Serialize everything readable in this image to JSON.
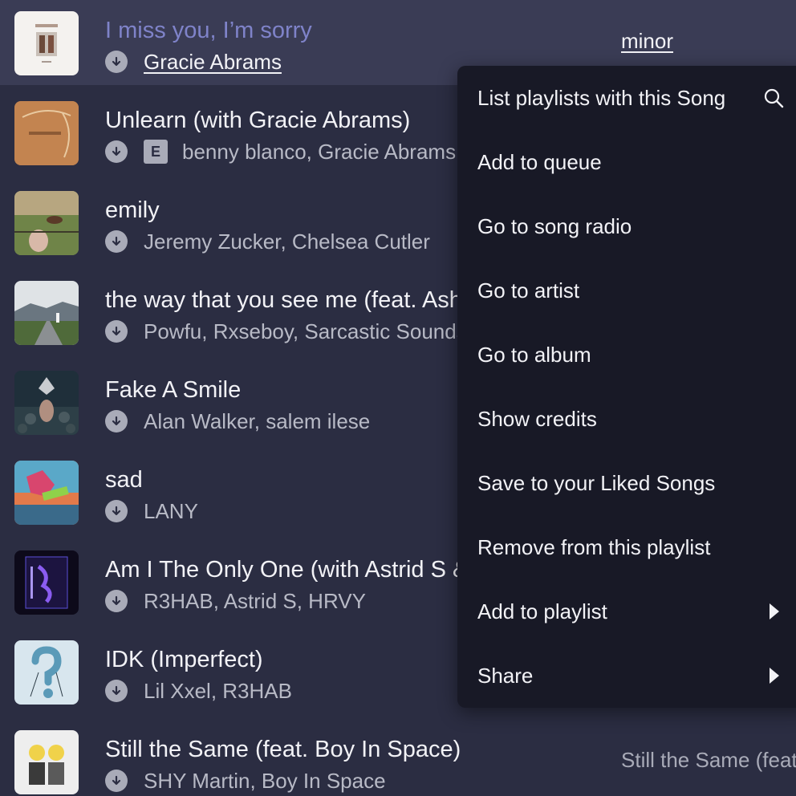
{
  "tracks": [
    {
      "title": "I miss you, I’m sorry",
      "artists": "Gracie Abrams",
      "explicit": false,
      "album": "minor",
      "selected": true
    },
    {
      "title": "Unlearn (with Gracie Abrams)",
      "artists": "benny blanco, Gracie Abrams",
      "explicit": true,
      "explicit_label": "E"
    },
    {
      "title": "emily",
      "artists": "Jeremy Zucker, Chelsea Cutler",
      "explicit": false
    },
    {
      "title": "the way that you see me (feat. Ashnikko)",
      "artists": "Powfu, Rxseboy, Sarcastic Sounds",
      "explicit": false
    },
    {
      "title": "Fake A Smile",
      "artists": "Alan Walker, salem ilese",
      "explicit": false
    },
    {
      "title": "sad",
      "artists": "LANY",
      "explicit": false
    },
    {
      "title": "Am I The Only One (with Astrid S & HRVY)",
      "artists": "R3HAB, Astrid S, HRVY",
      "explicit": false
    },
    {
      "title": "IDK (Imperfect)",
      "artists": "Lil Xxel, R3HAB",
      "explicit": false
    },
    {
      "title": "Still the Same (feat. Boy In Space)",
      "artists": "SHY Martin, Boy In Space",
      "explicit": false,
      "album": "Still the Same (feat. Boy In Space)"
    }
  ],
  "context_menu": {
    "items": [
      {
        "label": "List playlists with this Song",
        "icon": "search-icon"
      },
      {
        "label": "Add to queue"
      },
      {
        "label": "Go to song radio"
      },
      {
        "label": "Go to artist"
      },
      {
        "label": "Go to album"
      },
      {
        "label": "Show credits"
      },
      {
        "label": "Save to your Liked Songs"
      },
      {
        "label": "Remove from this playlist"
      },
      {
        "label": "Add to playlist",
        "icon": "chevron-right-icon"
      },
      {
        "label": "Share",
        "icon": "chevron-right-icon"
      }
    ]
  },
  "colors": {
    "background": "#2b2d42",
    "selected_row": "#3a3c55",
    "selected_title": "#7f83c9",
    "menu_background": "#181926"
  }
}
